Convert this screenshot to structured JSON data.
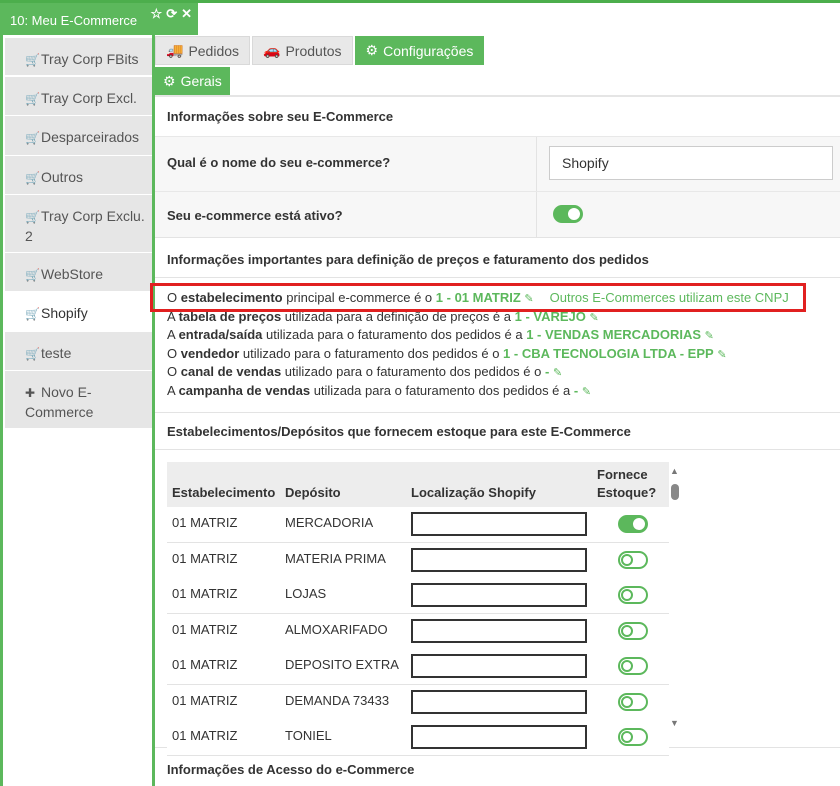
{
  "window": {
    "title": "10: Meu E-Commerce",
    "icons": [
      "star-outline-icon",
      "refresh-icon",
      "close-icon"
    ]
  },
  "sidebar": {
    "items": [
      {
        "label": "Tray Corp FBits",
        "icon": "cart-icon"
      },
      {
        "label": "Tray Corp Excl.",
        "icon": "cart-icon"
      },
      {
        "label": "Desparceirados",
        "icon": "cart-icon"
      },
      {
        "label": "Outros",
        "icon": "cart-icon"
      },
      {
        "label": "Tray Corp Exclu. 2",
        "icon": "cart-icon"
      },
      {
        "label": "WebStore",
        "icon": "cart-icon"
      },
      {
        "label": "Shopify",
        "icon": "cart-icon",
        "active": true
      },
      {
        "label": "teste",
        "icon": "cart-icon"
      },
      {
        "label": "Novo E-Commerce",
        "icon": "plus-icon"
      }
    ]
  },
  "tabs": [
    {
      "label": "Pedidos",
      "icon": "truck-icon"
    },
    {
      "label": "Produtos",
      "icon": "car-icon"
    },
    {
      "label": "Configurações",
      "icon": "gears-icon",
      "active": true
    }
  ],
  "subtab": {
    "label": "Gerais",
    "icon": "gears-icon"
  },
  "section_info": {
    "title": "Informações sobre seu E-Commerce",
    "name_question": "Qual é o nome do seu e-commerce?",
    "name_value": "Shopify",
    "active_question": "Seu e-commerce está ativo?",
    "active": true
  },
  "section_pricing": {
    "title": "Informações importantes para definição de preços e faturamento dos pedidos",
    "lines": [
      {
        "pre": "O ",
        "bold": "estabelecimento",
        "post": " principal e-commerce é o ",
        "value": "1 - 01 MATRIZ",
        "extra_link": "Outros E-Commerces utilizam este CNPJ"
      },
      {
        "pre": "A ",
        "bold": "tabela de preços",
        "post": " utilizada para a definição de preços é a ",
        "value": "1 - VAREJO"
      },
      {
        "pre": "A ",
        "bold": "entrada/saída",
        "post": " utilizada para o faturamento dos pedidos é a ",
        "value": "1 - VENDAS MERCADORIAS"
      },
      {
        "pre": "O ",
        "bold": "vendedor",
        "post": " utilizado para o faturamento dos pedidos é o ",
        "value": "1 - CBA TECNOLOGIA LTDA - EPP"
      },
      {
        "pre": "O ",
        "bold": "canal de vendas",
        "post": " utilizado para o faturamento dos pedidos é o ",
        "value": "-"
      },
      {
        "pre": "A ",
        "bold": "campanha de vendas",
        "post": " utilizada para o faturamento dos pedidos é a ",
        "value": "-"
      }
    ]
  },
  "section_stock": {
    "title": "Estabelecimentos/Depósitos que fornecem estoque para este E-Commerce",
    "columns": [
      "Estabelecimento",
      "Depósito",
      "Localização Shopify",
      "Fornece",
      "Estoque?"
    ],
    "rows": [
      {
        "estab": "01 MATRIZ",
        "deposito": "MERCADORIA",
        "location": "",
        "supplies": true
      },
      {
        "estab": "01 MATRIZ",
        "deposito": "MATERIA PRIMA",
        "location": "",
        "supplies": false
      },
      {
        "estab": "01 MATRIZ",
        "deposito": "LOJAS",
        "location": "",
        "supplies": false
      },
      {
        "estab": "01 MATRIZ",
        "deposito": "ALMOXARIFADO",
        "location": "",
        "supplies": false
      },
      {
        "estab": "01 MATRIZ",
        "deposito": "DEPOSITO EXTRA",
        "location": "",
        "supplies": false
      },
      {
        "estab": "01 MATRIZ",
        "deposito": "DEMANDA 73433",
        "location": "",
        "supplies": false
      },
      {
        "estab": "01 MATRIZ",
        "deposito": "TONIEL",
        "location": "",
        "supplies": false
      }
    ]
  },
  "section_access": {
    "title": "Informações de Acesso do e-Commerce"
  },
  "colors": {
    "accent": "#5cb85c",
    "highlight": "#e12020",
    "sidebar_bg": "#e6e6e6"
  }
}
